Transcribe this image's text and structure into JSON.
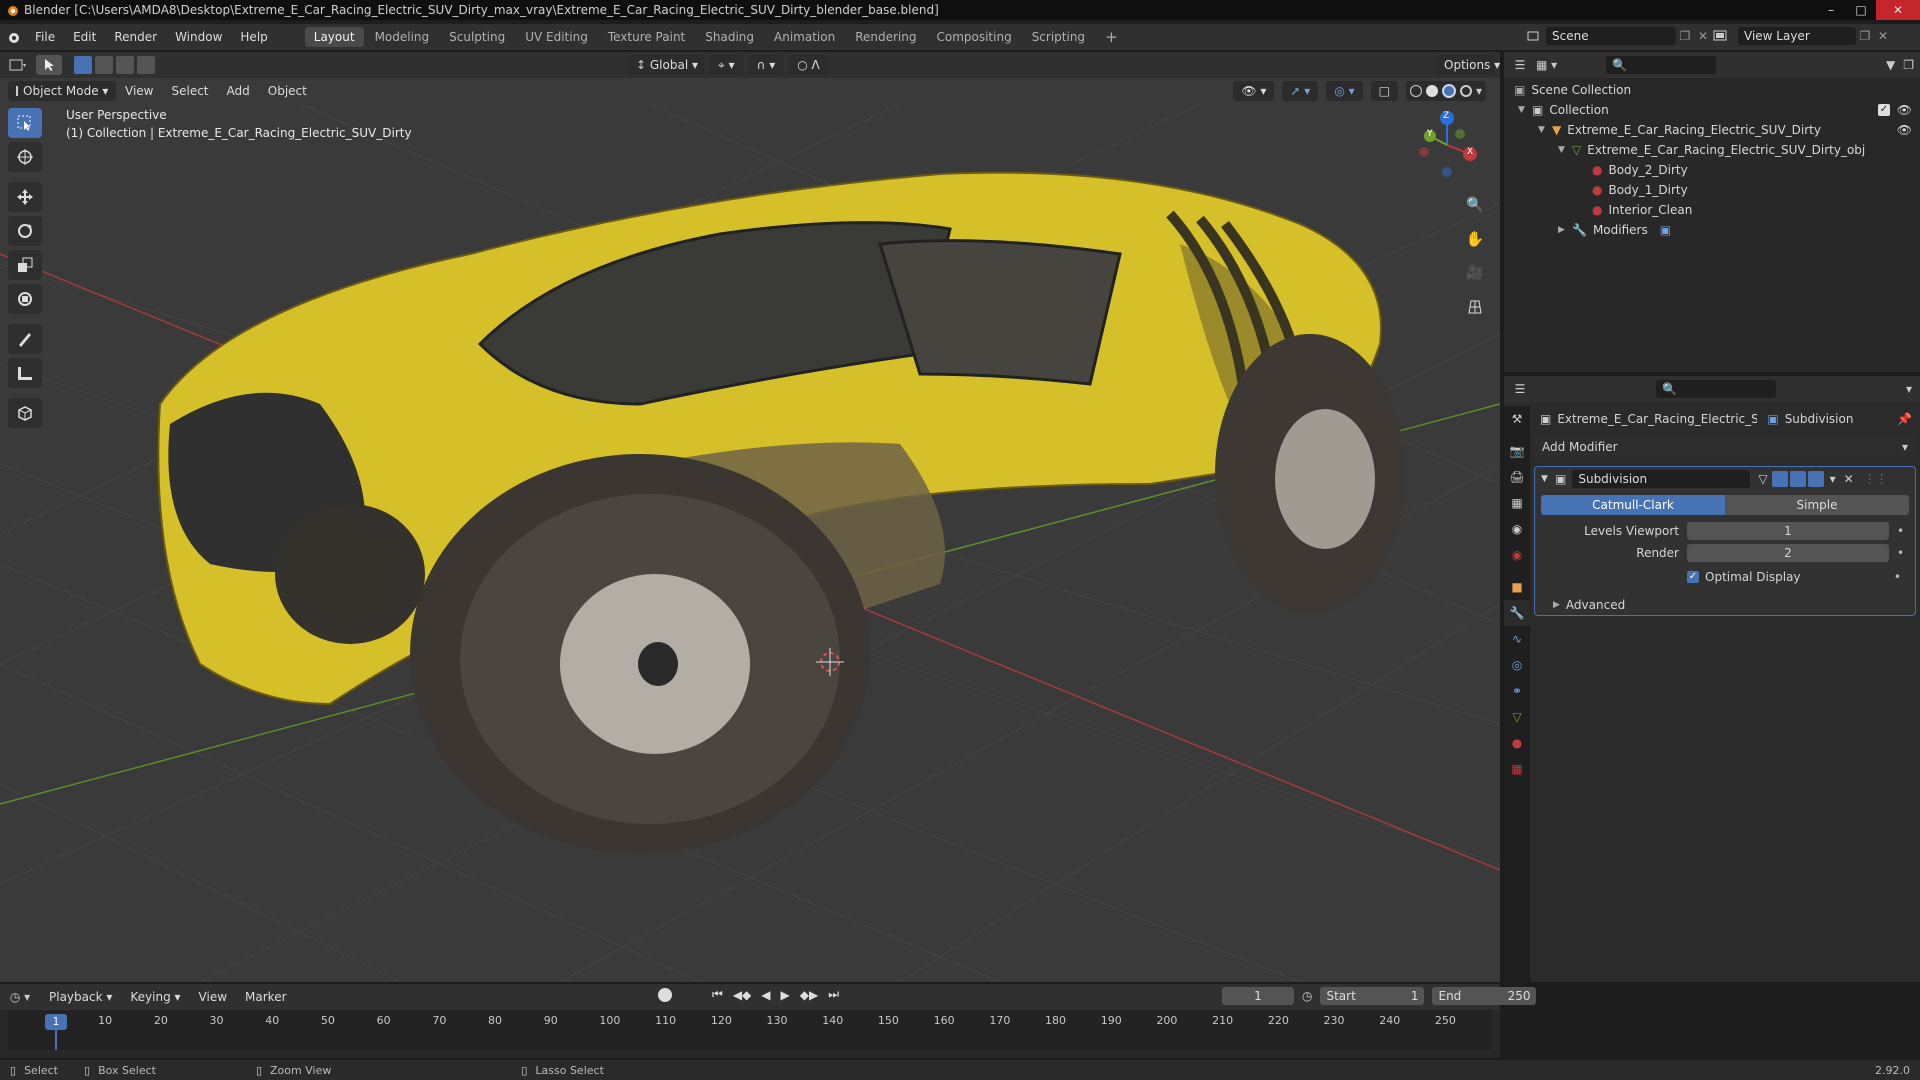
{
  "titlebar": {
    "title": "Blender [C:\\Users\\AMDA8\\Desktop\\Extreme_E_Car_Racing_Electric_SUV_Dirty_max_vray\\Extreme_E_Car_Racing_Electric_SUV_Dirty_blender_base.blend]"
  },
  "menu": [
    "File",
    "Edit",
    "Render",
    "Window",
    "Help"
  ],
  "workspaces": [
    "Layout",
    "Modeling",
    "Sculpting",
    "UV Editing",
    "Texture Paint",
    "Shading",
    "Animation",
    "Rendering",
    "Compositing",
    "Scripting"
  ],
  "active_workspace": "Layout",
  "scene": {
    "scene_name": "Scene",
    "view_layer": "View Layer"
  },
  "viewport": {
    "mode": "Object Mode",
    "header_menus": [
      "View",
      "Select",
      "Add",
      "Object"
    ],
    "transform_orientation": "Global",
    "options_label": "Options",
    "overlay_line1": "User Perspective",
    "overlay_line2": "(1) Collection | Extreme_E_Car_Racing_Electric_SUV_Dirty",
    "gizmo": {
      "x": "X",
      "y": "Y",
      "z": "Z"
    }
  },
  "outliner": {
    "scene_collection": "Scene Collection",
    "collection": "Collection",
    "object": "Extreme_E_Car_Racing_Electric_SUV_Dirty",
    "mesh": "Extreme_E_Car_Racing_Electric_SUV_Dirty_obj",
    "materials": [
      "Body_2_Dirty",
      "Body_1_Dirty",
      "Interior_Clean"
    ],
    "modifiers": "Modifiers"
  },
  "properties": {
    "object_name": "Extreme_E_Car_Racing_Electric_SUV_Di...",
    "modifier_header": "Subdivision",
    "add_modifier": "Add Modifier",
    "modifier_name": "Subdivision",
    "algo_options": [
      "Catmull-Clark",
      "Simple"
    ],
    "algo_selected": "Catmull-Clark",
    "levels_viewport_label": "Levels Viewport",
    "levels_viewport": "1",
    "render_label": "Render",
    "render_levels": "2",
    "optimal_display": "Optimal Display",
    "optimal_checked": true,
    "advanced": "Advanced"
  },
  "timeline": {
    "menus": [
      "Playback",
      "Keying",
      "View",
      "Marker"
    ],
    "current_frame": "1",
    "start_label": "Start",
    "start": "1",
    "end_label": "End",
    "end": "250",
    "ticks": [
      "10",
      "20",
      "30",
      "40",
      "50",
      "60",
      "70",
      "80",
      "90",
      "100",
      "110",
      "120",
      "130",
      "140",
      "150",
      "160",
      "170",
      "180",
      "190",
      "200",
      "210",
      "220",
      "230",
      "240",
      "250"
    ],
    "playhead": "1"
  },
  "statusbar": {
    "select": "Select",
    "box_select": "Box Select",
    "zoom_view": "Zoom View",
    "lasso_select": "Lasso Select",
    "version": "2.92.0"
  },
  "colors": {
    "accent": "#4772b3",
    "car_yellow": "#d9c52a",
    "x_axis": "#c0393e",
    "y_axis": "#6ea22d"
  }
}
